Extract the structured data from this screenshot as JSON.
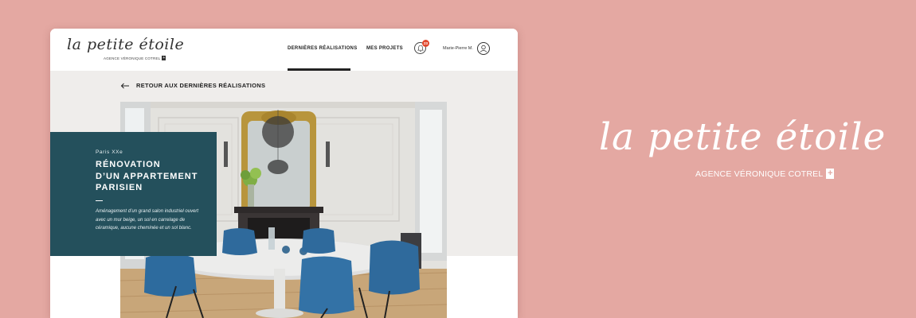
{
  "colors": {
    "background": "#e4a8a2",
    "teal_card": "#24505c",
    "badge": "#e0472d",
    "gray_band": "#efedeb"
  },
  "header": {
    "logo_text": "la petite étoile",
    "logo_subtitle": "AGENCE VÉRONIQUE COTREL",
    "logo_plus": "+",
    "nav": [
      {
        "label": "DERNIÈRES RÉALISATIONS",
        "active": true
      },
      {
        "label": "MES PROJETS",
        "active": false
      }
    ],
    "notifications": {
      "icon": "bell-icon",
      "count": "23"
    },
    "user": {
      "name": "Marie-Pierre M.",
      "icon": "user-icon"
    }
  },
  "back_link": {
    "icon": "arrow-left-icon",
    "label": "RETOUR AUX DERNIÈRES RÉALISATIONS"
  },
  "project_card": {
    "eyebrow": "Paris XXe",
    "title_lines": [
      "RÉNOVATION",
      "D’UN APPARTEMENT",
      "PARISIEN"
    ],
    "description": "Aménagement d’un grand salon industriel ouvert avec un mur beige, un sol en carrelage de céramique, aucune cheminée et un sol blanc."
  },
  "brand": {
    "script": "la petite étoile",
    "subtitle": "AGENCE VÉRONIQUE COTREL",
    "plus": "+"
  }
}
